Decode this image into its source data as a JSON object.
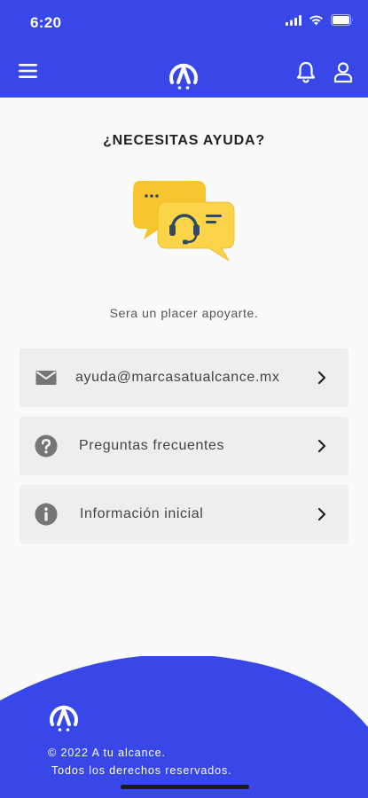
{
  "status_bar": {
    "time": "6:20"
  },
  "header": {
    "brand_color": "#3847e8"
  },
  "help": {
    "title": "¿NECESITAS AYUDA?",
    "subtitle": "Sera un placer apoyarte.",
    "options": [
      {
        "label": "ayuda@marcasatualcance.mx",
        "icon": "mail-icon"
      },
      {
        "label": "Preguntas frecuentes",
        "icon": "question-circle-icon"
      },
      {
        "label": "Información inicial",
        "icon": "info-circle-icon"
      }
    ]
  },
  "footer": {
    "copyright": "© 2022 A tu alcance.",
    "rights": "Todos los derechos reservados."
  },
  "colors": {
    "accent": "#3847e8",
    "card_bg": "#eeeeee",
    "icon_gray": "#757575",
    "illustration_yellow": "#f7c62f"
  }
}
